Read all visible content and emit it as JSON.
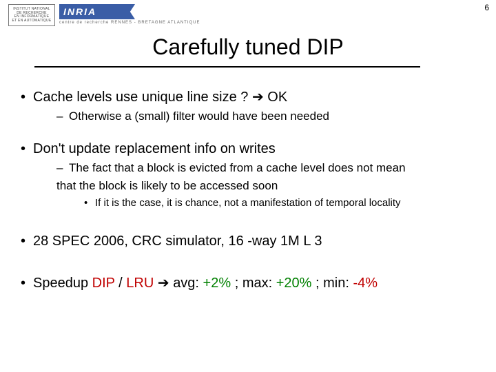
{
  "page_number": "6",
  "logo": {
    "left_line1": "INSTITUT NATIONAL",
    "left_line2": "DE RECHERCHE",
    "left_line3": "EN INFORMATIQUE",
    "left_line4": "ET EN AUTOMATIQUE",
    "inria": "INRIA",
    "sub": "centre de recherche RENNES - BRETAGNE ATLANTIQUE"
  },
  "title": "Carefully tuned DIP",
  "b1": {
    "text_a": "Cache levels use unique line size ? ",
    "arrow": "➔",
    "text_b": " OK",
    "sub1": "Otherwise a (small) filter would have been needed"
  },
  "b2": {
    "text": "Don't update replacement info on writes",
    "sub1a": "The fact that a block is evicted from a cache level does not mean",
    "sub1b": "that the block is likely to be accessed soon",
    "sub2": "If it is the case, it is chance, not a manifestation of temporal locality"
  },
  "b3": {
    "text": "28 SPEC 2006, CRC simulator, 16 -way 1M L 3"
  },
  "b4": {
    "pre": "Speedup ",
    "dip": "DIP",
    "slash": " / ",
    "lru": "LRU",
    "arrow": " ➔ ",
    "avg_lbl": "avg: ",
    "avg_val": "+2%",
    "sep1": " ; ",
    "max_lbl": "max: ",
    "max_val": "+20%",
    "sep2": " ; ",
    "min_lbl": "min: ",
    "min_val": "-4%"
  }
}
